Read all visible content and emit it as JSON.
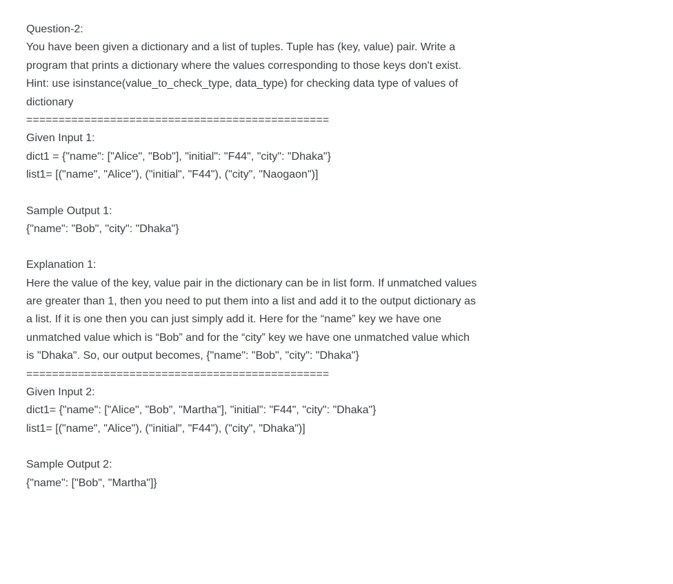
{
  "doc": {
    "question_label": "Question-2:",
    "prompt_line1": "You have been given a dictionary and a list of tuples. Tuple has (key, value) pair. Write a",
    "prompt_line2": "program that prints a dictionary where the values corresponding to those keys don't exist.",
    "hint_line1": "Hint: use isinstance(value_to_check_type, data_type) for checking data type of values of",
    "hint_line2": "dictionary",
    "divider1": "===============================================",
    "input1_label": "Given Input 1:",
    "input1_dict": "dict1 = {\"name\": [\"Alice\", \"Bob\"], \"initial\": \"F44\", \"city\": \"Dhaka\"}",
    "input1_list": "list1= [(\"name\", \"Alice\"), (\"initial\", \"F44\"), (\"city\", \"Naogaon\")]",
    "output1_label": "Sample Output 1:",
    "output1_value": "{\"name\": \"Bob\", \"city\": \"Dhaka\"}",
    "explanation1_label": "Explanation 1:",
    "explanation1_line1": "Here the value of the key, value pair in the dictionary can be in list form. If unmatched values",
    "explanation1_line2": "are greater than 1, then you need to put them into a list and add it to the output dictionary as",
    "explanation1_line3": "a list. If it is one then you can just simply add it. Here for the “name” key we have one",
    "explanation1_line4": "unmatched value which is “Bob” and for the “city” key we have one unmatched value which",
    "explanation1_line5": "is \"Dhaka\". So, our output becomes, {\"name\": \"Bob\", \"city\": \"Dhaka\"}",
    "divider2": "===============================================",
    "input2_label": "Given Input 2:",
    "input2_dict": "dict1= {\"name\": [\"Alice\", \"Bob\", \"Martha\"], \"initial\": \"F44\", \"city\": \"Dhaka\"}",
    "input2_list": "list1= [(\"name\", \"Alice\"), (\"initial\", \"F44\"), (\"city\", \"Dhaka\")]",
    "output2_label": "Sample Output 2:",
    "output2_value": "{\"name\": [\"Bob\", \"Martha\"]}"
  }
}
